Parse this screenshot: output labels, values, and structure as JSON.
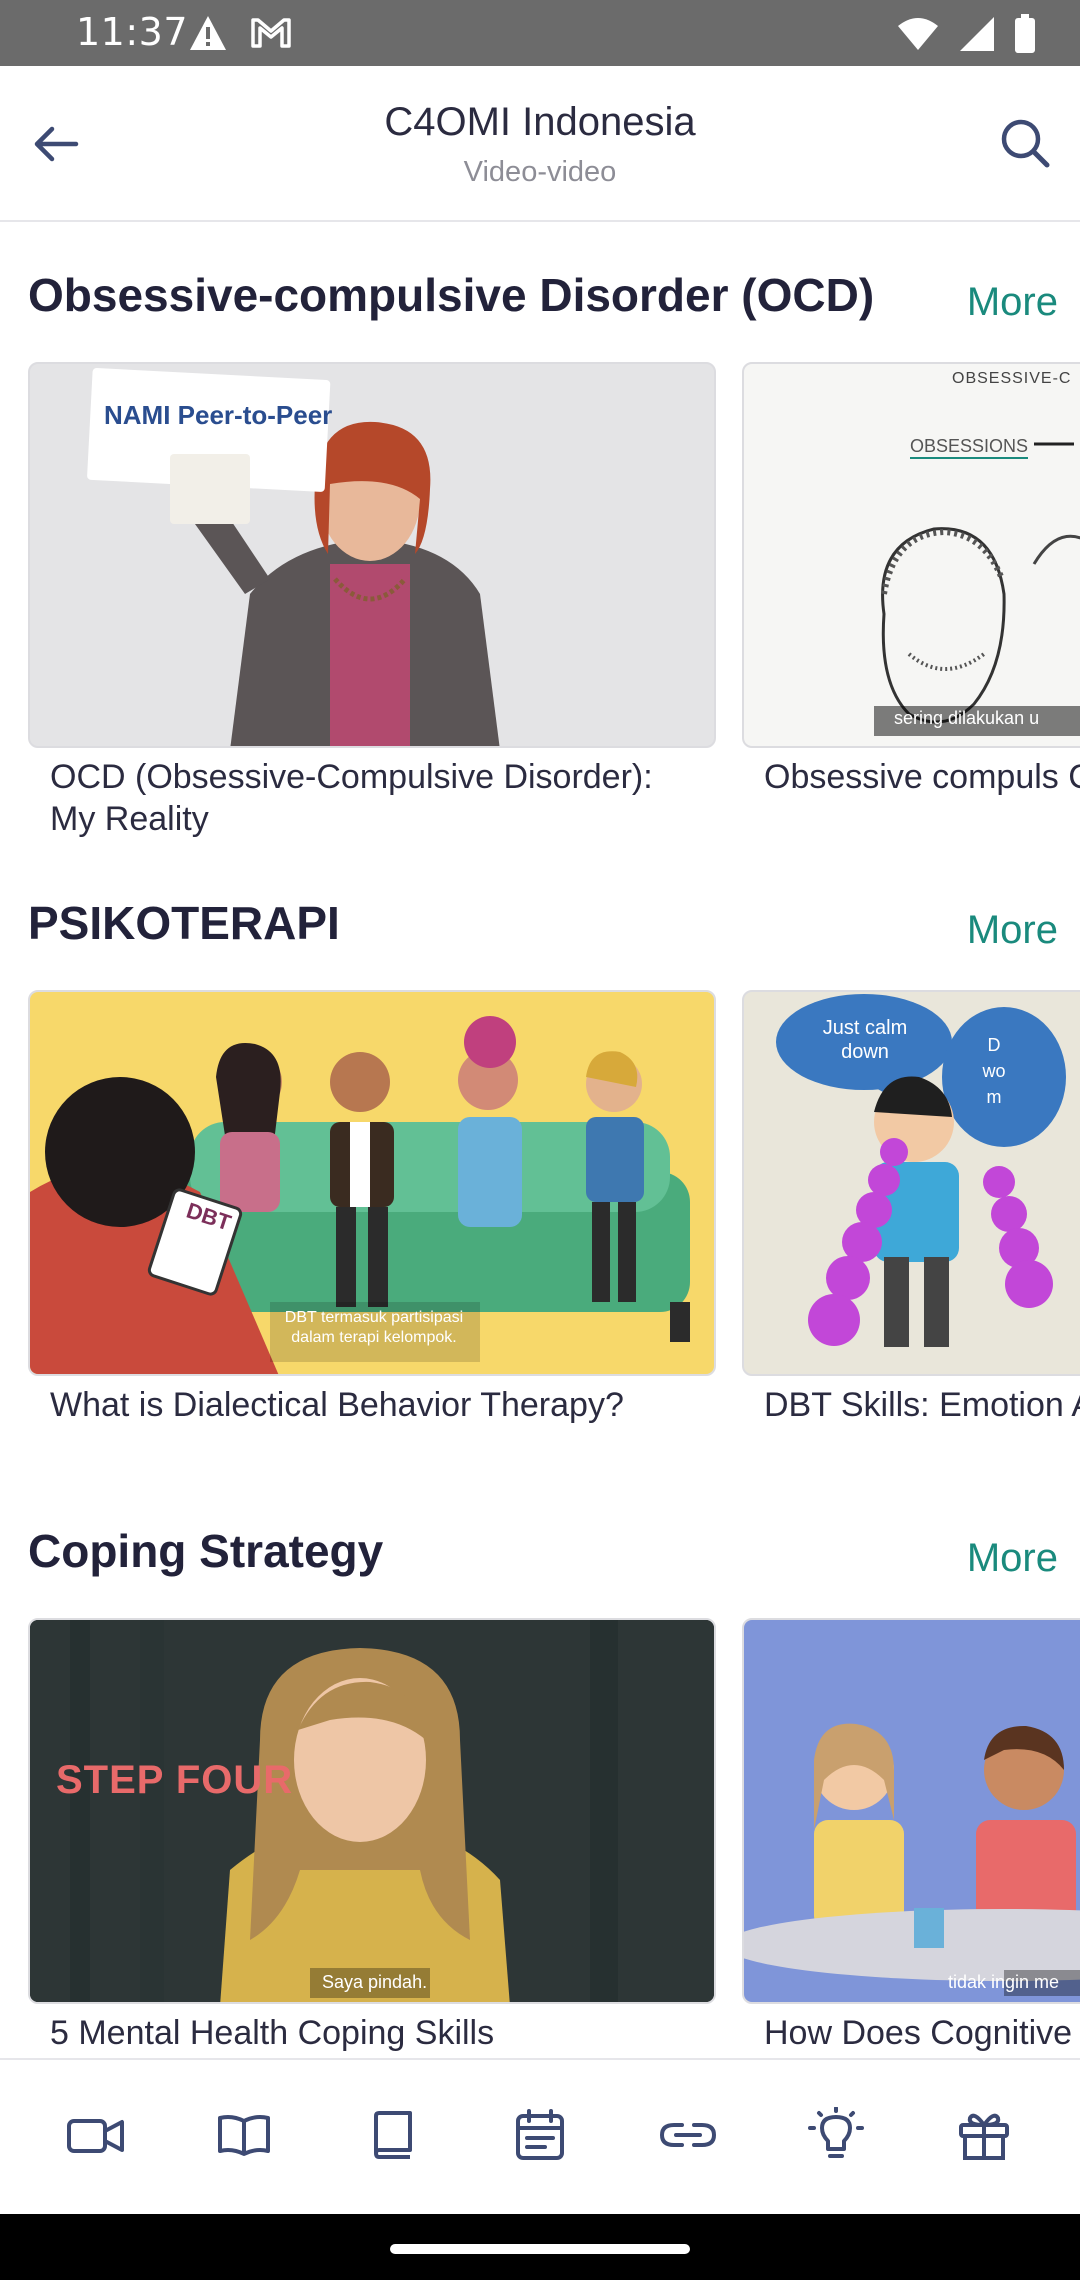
{
  "status_bar": {
    "time": "11:37",
    "icons": [
      "warning-icon",
      "gmail-icon",
      "wifi-icon",
      "signal-icon",
      "battery-icon"
    ]
  },
  "header": {
    "title": "C4OMI Indonesia",
    "subtitle": "Video-video",
    "back_icon": "arrow-left-icon",
    "search_icon": "search-icon"
  },
  "sections": [
    {
      "title": "Obsessive-compulsive Disorder (OCD)",
      "more_label": "More",
      "videos": [
        {
          "title": "OCD (Obsessive-Compulsive Disorder): My Reality",
          "thumb_sign": "NAMI Peer-to-Peer"
        },
        {
          "title": "Obsessive compuls Causes, symptoms",
          "thumb_text_1": "OBSESSIVE-C",
          "thumb_text_2": "OBSESSIONS",
          "thumb_caption": "sering dilakukan u"
        }
      ]
    },
    {
      "title": "PSIKOTERAPI",
      "more_label": "More",
      "videos": [
        {
          "title": "What is Dialectical Behavior Therapy?",
          "thumb_badge": "DBT",
          "thumb_caption": "DBT termasuk partisipasi dalam terapi kelompok."
        },
        {
          "title": "DBT Skills: Emotion Acceptance",
          "thumb_bubble": "Just calm down",
          "thumb_bubble_2": "D wo m"
        }
      ]
    },
    {
      "title": "Coping Strategy",
      "more_label": "More",
      "videos": [
        {
          "title": "5 Mental Health Coping Skills",
          "thumb_overlay": "STEP FOUR",
          "thumb_caption": "Saya pindah."
        },
        {
          "title": "How Does Cognitive",
          "thumb_caption": "tidak ingin me"
        }
      ]
    }
  ],
  "bottom_nav": [
    {
      "icon": "video-camera-icon"
    },
    {
      "icon": "open-book-icon"
    },
    {
      "icon": "book-icon"
    },
    {
      "icon": "calendar-icon"
    },
    {
      "icon": "link-icon"
    },
    {
      "icon": "lightbulb-icon"
    },
    {
      "icon": "gift-icon"
    }
  ],
  "colors": {
    "accent": "#1a8a7d",
    "status_bar": "#6b6b6b",
    "text": "#2b2b40",
    "icon": "#3d4a73"
  }
}
